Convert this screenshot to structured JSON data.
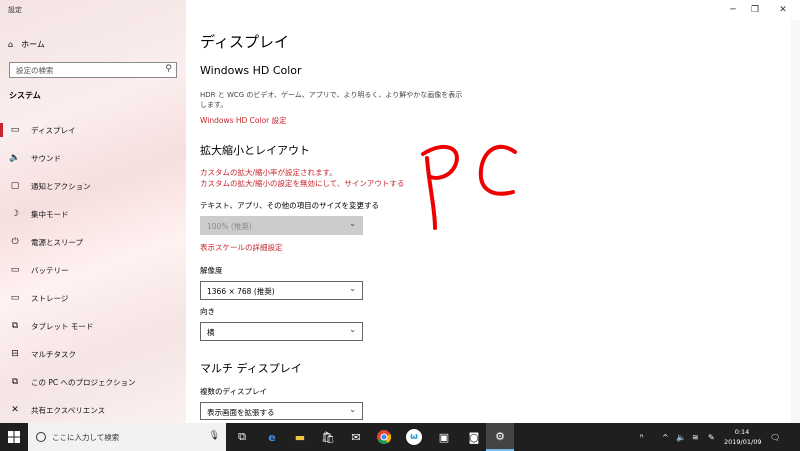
{
  "window": {
    "title": "設定",
    "minimize": "─",
    "restore": "❐",
    "close": "✕"
  },
  "sidebar": {
    "home_label": "ホーム",
    "search_placeholder": "設定の検索",
    "section": "システム",
    "items": [
      {
        "label": "ディスプレイ",
        "icon": "display-icon",
        "glyph": "▭",
        "active": true
      },
      {
        "label": "サウンド",
        "icon": "sound-icon",
        "glyph": "🔈"
      },
      {
        "label": "通知とアクション",
        "icon": "notification-icon",
        "glyph": "▢"
      },
      {
        "label": "集中モード",
        "icon": "moon-icon",
        "glyph": "☽"
      },
      {
        "label": "電源とスリープ",
        "icon": "power-icon",
        "glyph": "⏻"
      },
      {
        "label": "バッテリー",
        "icon": "battery-icon",
        "glyph": "▭"
      },
      {
        "label": "ストレージ",
        "icon": "storage-icon",
        "glyph": "▭"
      },
      {
        "label": "タブレット モード",
        "icon": "tablet-icon",
        "glyph": "⧉"
      },
      {
        "label": "マルチタスク",
        "icon": "multitask-icon",
        "glyph": "⊟"
      },
      {
        "label": "この PC へのプロジェクション",
        "icon": "projection-icon",
        "glyph": "⧉"
      },
      {
        "label": "共有エクスペリエンス",
        "icon": "share-icon",
        "glyph": "✕"
      }
    ]
  },
  "main": {
    "title": "ディスプレイ",
    "hd_color": {
      "heading": "Windows HD Color",
      "description": "HDR と WCG のビデオ、ゲーム、アプリで、より明るく、より鮮やかな画像を表示します。",
      "link": "Windows HD Color 設定"
    },
    "scale": {
      "heading": "拡大縮小とレイアウト",
      "warning_1": "カスタムの拡大/縮小率が設定されます。",
      "warning_2": "カスタムの拡大/縮小の設定を無効にして、サインアウトする",
      "size_label": "テキスト、アプリ、その他の項目のサイズを変更する",
      "size_value": "100% (推奨)",
      "advanced_link": "表示スケールの詳細設定",
      "resolution_label": "解像度",
      "resolution_value": "1366 × 768 (推奨)",
      "orientation_label": "向き",
      "orientation_value": "横"
    },
    "multi": {
      "heading": "マルチ ディスプレイ",
      "label": "複数のディスプレイ",
      "value": "表示画面を拡張する"
    },
    "annotation": "PC"
  },
  "taskbar": {
    "search_placeholder": "ここに入力して検索",
    "time": "0:14",
    "date": "2019/01/09",
    "accent": "#c6262e"
  }
}
